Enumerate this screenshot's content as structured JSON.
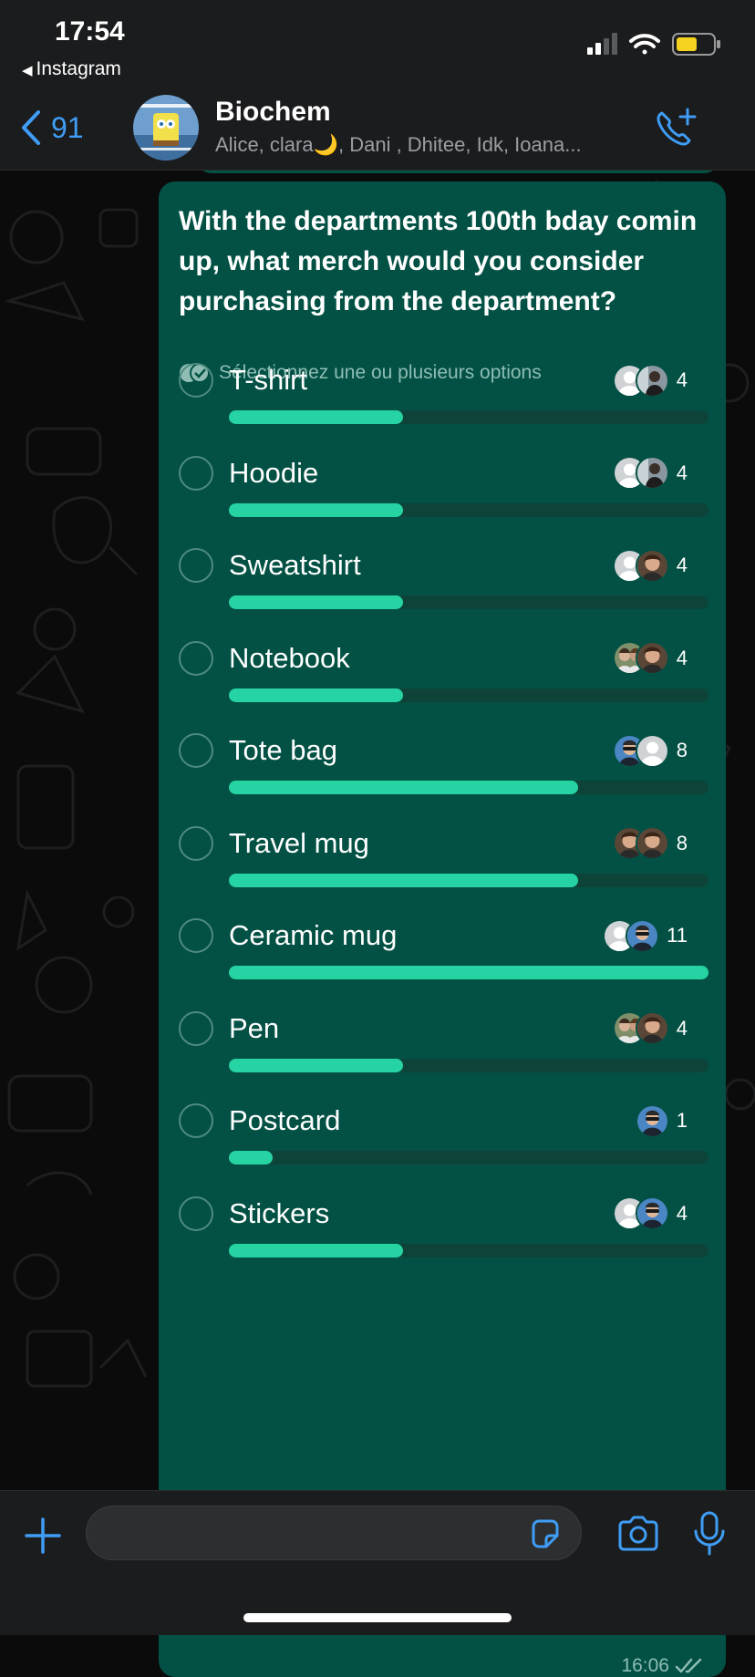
{
  "status_bar": {
    "time": "17:54",
    "back_app": "Instagram"
  },
  "header": {
    "back_count": "91",
    "title": "Biochem",
    "members": "Alice, clara🌙, Dani , Dhitee, Idk, Ioana..."
  },
  "poll": {
    "question": "With the departments 100th bday comin up, what merch would you consider purchasing from the department?",
    "hint": "Sélectionnez une ou plusieurs options",
    "max_votes": 11,
    "options": [
      {
        "label": "T-shirt",
        "votes": "4",
        "value": 4
      },
      {
        "label": "Hoodie",
        "votes": "4",
        "value": 4
      },
      {
        "label": "Sweatshirt",
        "votes": "4",
        "value": 4
      },
      {
        "label": "Notebook",
        "votes": "4",
        "value": 4
      },
      {
        "label": "Tote bag",
        "votes": "8",
        "value": 8
      },
      {
        "label": "Travel mug",
        "votes": "8",
        "value": 8
      },
      {
        "label": "Ceramic mug",
        "votes": "11",
        "value": 11
      },
      {
        "label": "Pen",
        "votes": "4",
        "value": 4
      },
      {
        "label": "Postcard",
        "votes": "1",
        "value": 1
      },
      {
        "label": "Stickers",
        "votes": "4",
        "value": 4
      }
    ],
    "time": "16:06"
  },
  "colors": {
    "bubble": "#025144",
    "bar_fill": "#25d4a2",
    "bar_track": "#0e4339",
    "accent": "#3f9df5"
  }
}
